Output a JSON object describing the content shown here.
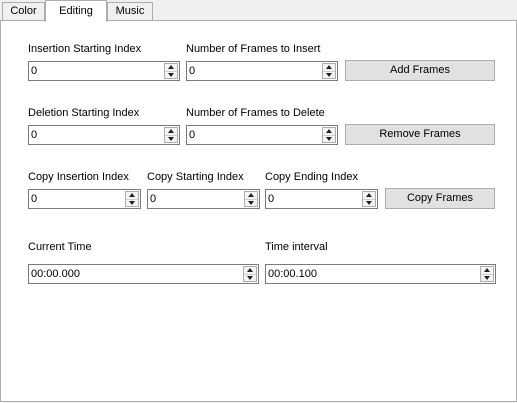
{
  "tabs": [
    {
      "label": "Color",
      "active": false
    },
    {
      "label": "Editing",
      "active": true
    },
    {
      "label": "Music",
      "active": false
    }
  ],
  "insertion": {
    "start_label": "Insertion Starting Index",
    "start_value": "0",
    "count_label": "Number of Frames to Insert",
    "count_value": "0",
    "button": "Add Frames"
  },
  "deletion": {
    "start_label": "Deletion Starting Index",
    "start_value": "0",
    "count_label": "Number of Frames to Delete",
    "count_value": "0",
    "button": "Remove Frames"
  },
  "copy": {
    "insert_label": "Copy Insertion Index",
    "insert_value": "0",
    "start_label": "Copy Starting Index",
    "start_value": "0",
    "end_label": "Copy Ending Index",
    "end_value": "0",
    "button": "Copy Frames"
  },
  "time": {
    "current_label": "Current Time",
    "current_value": "00:00.000",
    "interval_label": "Time interval",
    "interval_value": "00:00.100"
  }
}
